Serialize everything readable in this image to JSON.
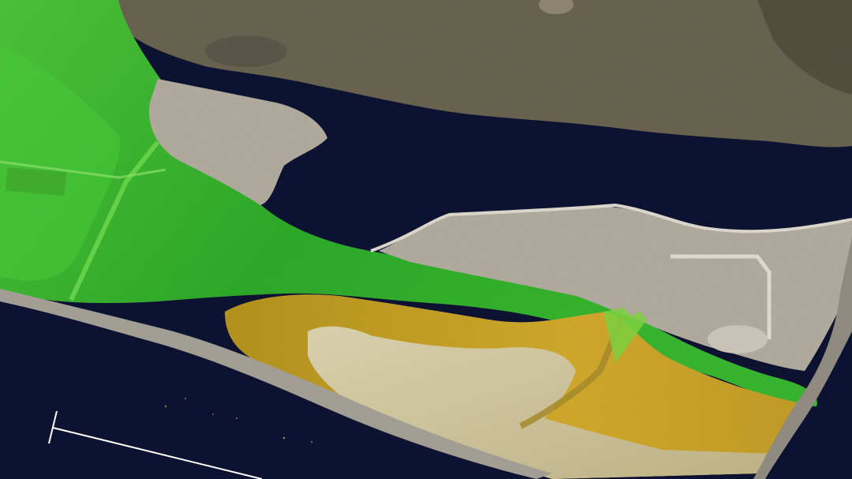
{
  "view": {
    "type": "lidar-shaded-relief-terrain",
    "colors": {
      "water": "#0c1230",
      "water_far": "#121937",
      "upland_gray": "#6b6552",
      "urban_gray": "#b5b0a2",
      "lowland_green": "#33b82e",
      "green_bright": "#5fd43a",
      "cliff_yellow": "#c9a228",
      "plateau_tan": "#d8d0a8",
      "ochre": "#b8963a",
      "beach_edge": "#a8a49a",
      "scale_bar": "#ffffff"
    }
  },
  "scale_bar": {
    "label": ""
  }
}
